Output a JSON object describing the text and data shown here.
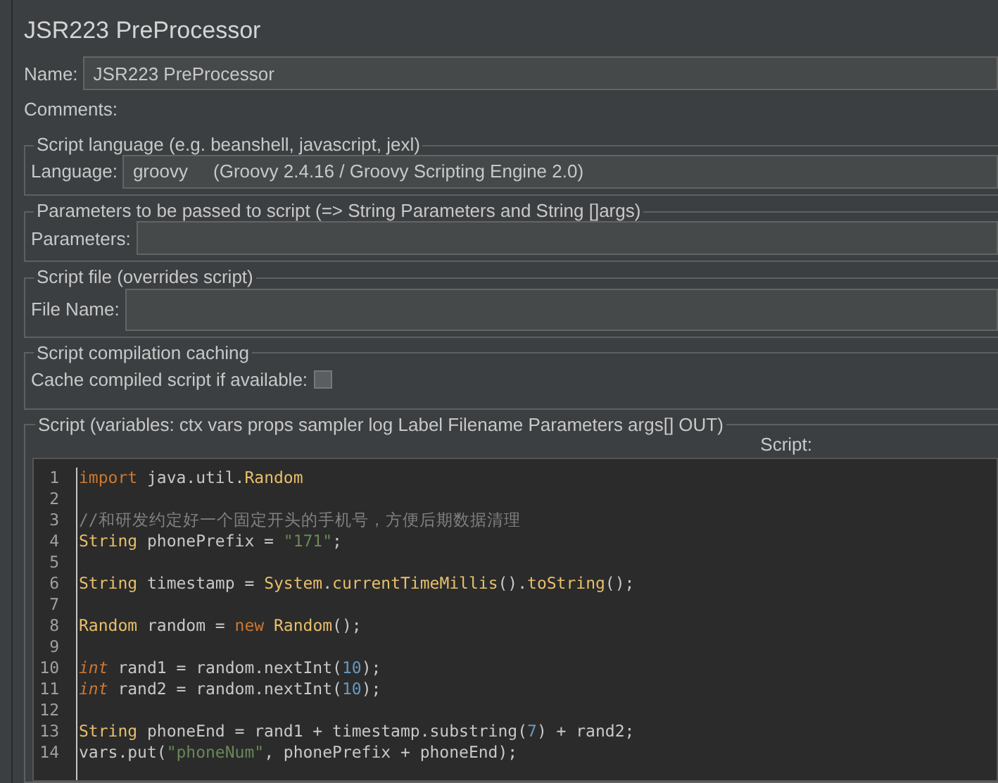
{
  "window": {
    "title": "JSR223 PreProcessor"
  },
  "name": {
    "label": "Name:",
    "value": "JSR223 PreProcessor"
  },
  "comments": {
    "label": "Comments:"
  },
  "script_language": {
    "title": "Script language (e.g. beanshell, javascript, jexl)",
    "label": "Language:",
    "value": "groovy     (Groovy 2.4.16 / Groovy Scripting Engine 2.0)"
  },
  "parameters": {
    "title": "Parameters to be passed to script (=> String Parameters and String []args)",
    "label": "Parameters:"
  },
  "script_file": {
    "title": "Script file (overrides script)",
    "label": "File Name:"
  },
  "caching": {
    "title": "Script compilation caching",
    "label": "Cache compiled script if available:",
    "checked": false
  },
  "script": {
    "title": "Script (variables: ctx vars props sampler log Label Filename Parameters args[] OUT)",
    "editor_label": "Script:",
    "lines": [
      {
        "number": "1",
        "tokens": [
          {
            "kind": "keyword",
            "text": "import"
          },
          {
            "kind": "plain",
            "text": " java.util."
          },
          {
            "kind": "type",
            "text": "Random"
          }
        ]
      },
      {
        "number": "2"
      },
      {
        "number": "3",
        "tokens": [
          {
            "kind": "comment",
            "text": "//和研发约定好一个固定开头的手机号，方便后期数据清理"
          }
        ]
      },
      {
        "number": "4",
        "tokens": [
          {
            "kind": "type",
            "text": "String"
          },
          {
            "kind": "plain",
            "text": " phonePrefix = "
          },
          {
            "kind": "string",
            "text": "\"171\""
          },
          {
            "kind": "plain",
            "text": ";"
          }
        ]
      },
      {
        "number": "5"
      },
      {
        "number": "6",
        "tokens": [
          {
            "kind": "type",
            "text": "String"
          },
          {
            "kind": "plain",
            "text": " timestamp = "
          },
          {
            "kind": "type",
            "text": "System"
          },
          {
            "kind": "plain",
            "text": "."
          },
          {
            "kind": "type",
            "text": "currentTimeMillis"
          },
          {
            "kind": "plain",
            "text": "()."
          },
          {
            "kind": "type",
            "text": "toString"
          },
          {
            "kind": "plain",
            "text": "();"
          }
        ]
      },
      {
        "number": "7"
      },
      {
        "number": "8",
        "tokens": [
          {
            "kind": "type",
            "text": "Random"
          },
          {
            "kind": "plain",
            "text": " random = "
          },
          {
            "kind": "keyword",
            "text": "new "
          },
          {
            "kind": "type",
            "text": "Random"
          },
          {
            "kind": "plain",
            "text": "();"
          }
        ]
      },
      {
        "number": "9"
      },
      {
        "number": "10",
        "tokens": [
          {
            "kind": "primitive",
            "text": "int"
          },
          {
            "kind": "plain",
            "text": " rand1 = random.nextInt("
          },
          {
            "kind": "number",
            "text": "10"
          },
          {
            "kind": "plain",
            "text": ");"
          }
        ]
      },
      {
        "number": "11",
        "tokens": [
          {
            "kind": "primitive",
            "text": "int"
          },
          {
            "kind": "plain",
            "text": " rand2 = random.nextInt("
          },
          {
            "kind": "number",
            "text": "10"
          },
          {
            "kind": "plain",
            "text": ");"
          }
        ]
      },
      {
        "number": "12"
      },
      {
        "number": "13",
        "tokens": [
          {
            "kind": "type",
            "text": "String"
          },
          {
            "kind": "plain",
            "text": " phoneEnd = rand1 + timestamp.substring("
          },
          {
            "kind": "number",
            "text": "7"
          },
          {
            "kind": "plain",
            "text": ") + rand2;"
          }
        ]
      },
      {
        "number": "14",
        "tokens": [
          {
            "kind": "plain",
            "text": "vars.put("
          },
          {
            "kind": "string",
            "text": "\"phoneNum\""
          },
          {
            "kind": "plain",
            "text": ", phonePrefix + phoneEnd);"
          }
        ]
      }
    ]
  }
}
